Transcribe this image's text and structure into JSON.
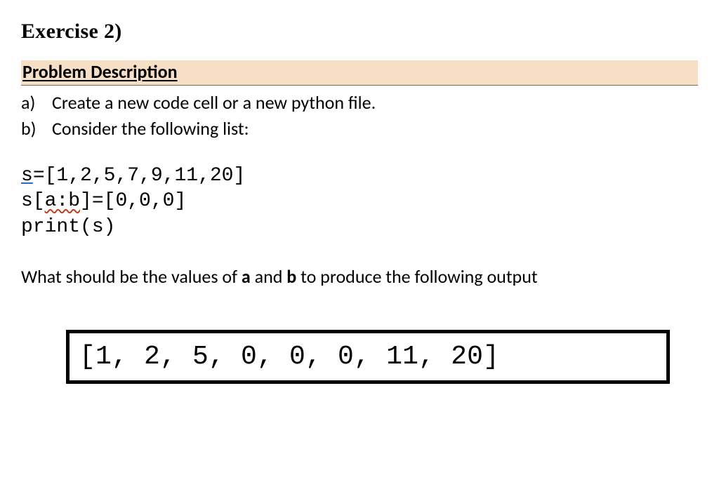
{
  "exercise_title": "Exercise 2)",
  "section_header": "Problem Description",
  "items": [
    {
      "label": "a)",
      "text": "Create a new code cell or a new python file."
    },
    {
      "label": "b)",
      "text": "Consider the following list:"
    }
  ],
  "code": {
    "line1_part1": "s",
    "line1_part2": "=[1,2,5,7,9,11,20]",
    "line2_part1": "s[",
    "line2_part2": "a:b",
    "line2_part3": "]=[0,0,0]",
    "line3": "print(s)"
  },
  "question_prefix": "What should be the values of ",
  "question_a": "a",
  "question_and": " and ",
  "question_b": "b",
  "question_suffix": " to produce the following output",
  "output": "[1, 2, 5, 0, 0, 0, 11, 20]"
}
